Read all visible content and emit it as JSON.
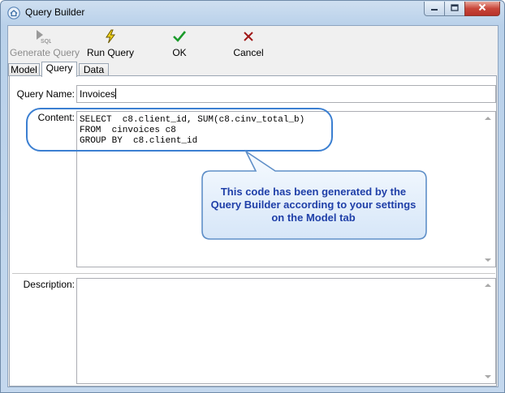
{
  "window": {
    "title": "Query Builder",
    "app_icon": "home-icon",
    "controls": {
      "minimize": "minimize-icon",
      "maximize": "maximize-icon",
      "close": "close-icon"
    }
  },
  "toolbar": {
    "generate": {
      "label": "Generate Query",
      "icon": "generate-sql-icon",
      "enabled": false
    },
    "run": {
      "label": "Run Query",
      "icon": "lightning-icon"
    },
    "ok": {
      "label": "OK",
      "icon": "checkmark-icon"
    },
    "cancel": {
      "label": "Cancel",
      "icon": "x-icon"
    }
  },
  "tabs": [
    {
      "label": "Model",
      "active": false
    },
    {
      "label": "Query",
      "active": true
    },
    {
      "label": "Data",
      "active": false
    }
  ],
  "form": {
    "query_name_label": "Query Name:",
    "query_name_value": "Invoices",
    "content_label": "Content:",
    "content_lines": [
      "SELECT  c8.client_id, SUM(c8.cinv_total_b)",
      "FROM  cinvoices c8",
      "GROUP BY  c8.client_id"
    ],
    "description_label": "Description:",
    "description_value": ""
  },
  "callout": {
    "text_lines": [
      "This code has been generated by the",
      "Query Builder according to your settings",
      "on the Model tab"
    ]
  },
  "colors": {
    "callout_text": "#1f3fa8",
    "callout_border": "#3b7fd1",
    "ok_icon": "#1a9a2a",
    "cancel_icon": "#a01818",
    "run_icon": "#e0b400"
  }
}
